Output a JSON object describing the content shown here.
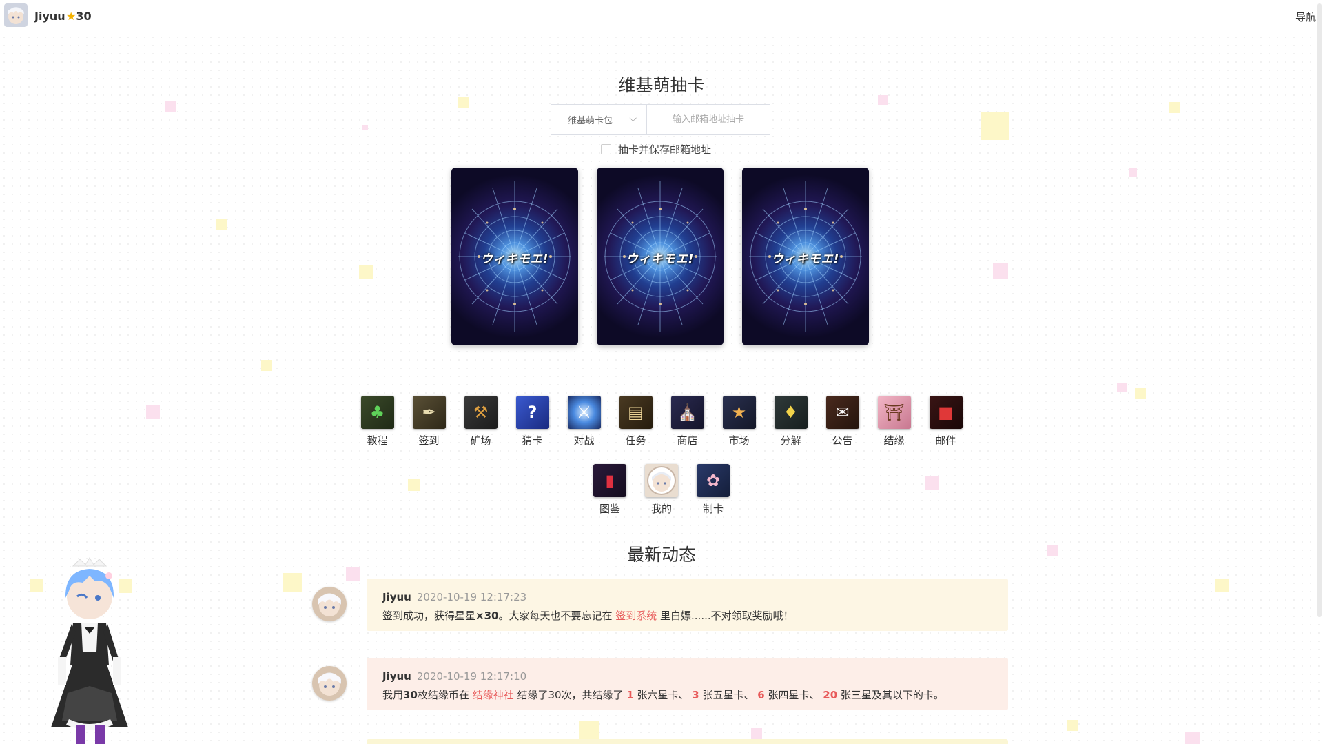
{
  "header": {
    "username": "Jiyuu",
    "star_icon": "★",
    "stars": "30",
    "nav_label": "导航"
  },
  "draw": {
    "title": "维基萌抽卡",
    "pack_select": "维基萌卡包",
    "email_placeholder": "输入邮箱地址抽卡",
    "save_email_label": "抽卡并保存邮箱地址",
    "card_back_text": "ウィキモエ!"
  },
  "menu": {
    "row1": [
      {
        "label": "教程",
        "icon": "clover-icon"
      },
      {
        "label": "签到",
        "icon": "quill-icon"
      },
      {
        "label": "矿场",
        "icon": "pickaxe-icon"
      },
      {
        "label": "猜卡",
        "icon": "question-card-icon"
      },
      {
        "label": "对战",
        "icon": "battle-icon"
      },
      {
        "label": "任务",
        "icon": "scroll-icon"
      },
      {
        "label": "商店",
        "icon": "shop-icon"
      },
      {
        "label": "市场",
        "icon": "market-bag-icon"
      },
      {
        "label": "分解",
        "icon": "crystal-icon"
      },
      {
        "label": "公告",
        "icon": "notice-icon"
      },
      {
        "label": "结缘",
        "icon": "shrine-icon"
      },
      {
        "label": "邮件",
        "icon": "mailbox-icon"
      }
    ],
    "row2": [
      {
        "label": "图鉴",
        "icon": "book-icon"
      },
      {
        "label": "我的",
        "icon": "profile-icon"
      },
      {
        "label": "制卡",
        "icon": "card-make-icon"
      }
    ]
  },
  "feed": {
    "title": "最新动态",
    "items": [
      {
        "user": "Jiyuu",
        "time": "2020-10-19 12:17:23",
        "t1": "签到成功，获得星星",
        "t1b": "×30",
        "t2": "。大家每天也不要忘记在 ",
        "link": "签到系统",
        "t3": " 里白嫖......不对领取奖励哦！"
      },
      {
        "user": "Jiyuu",
        "time": "2020-10-19 12:17:10",
        "t1": "我用",
        "t1b": "30",
        "t2": "枚结缘币在 ",
        "link": "结缘神社",
        "t3": " 结缘了30次，共结缘了 ",
        "n1": "1",
        "t4": " 张六星卡、 ",
        "n2": "3",
        "t5": " 张五星卡、 ",
        "n3": "6",
        "t6": " 张四星卡、 ",
        "n4": "20",
        "t7": " 张三星及其以下的卡。"
      }
    ]
  },
  "colors": {
    "link": "#e85a5a",
    "star": "#f5b301",
    "feed_bg_1": "#fdf6e4",
    "feed_bg_2": "#fdeee8"
  }
}
